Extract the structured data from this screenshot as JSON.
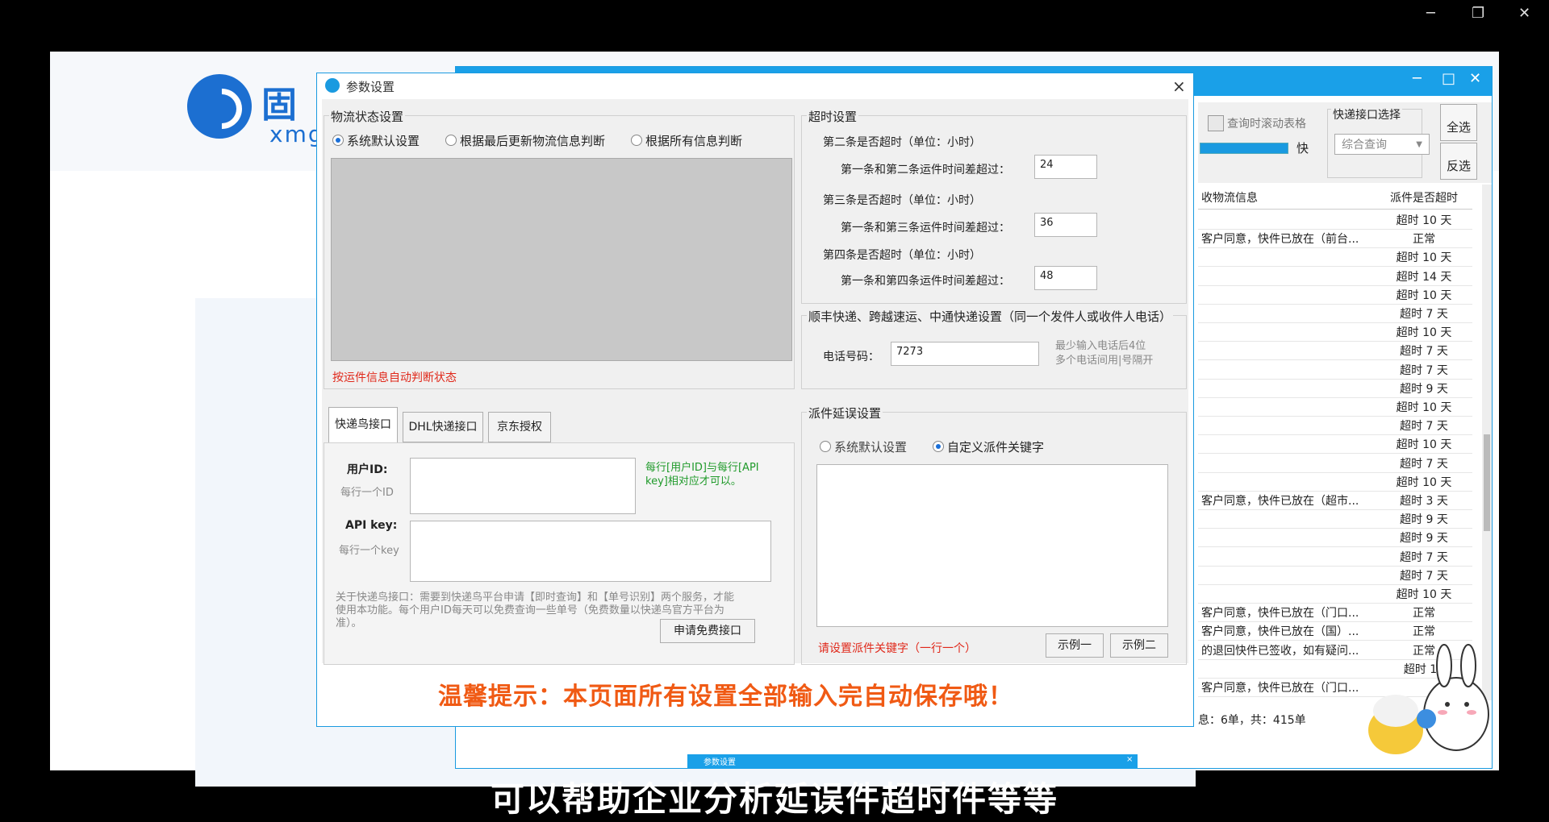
{
  "window_controls": {
    "min": "─",
    "restore": "❐",
    "close": "✕"
  },
  "logo": {
    "text": "固",
    "sub": "xmg"
  },
  "app": {
    "scroll_checkbox_label": "查询时滚动表格",
    "fast_label": "快",
    "api_group_title": "快递接口选择",
    "api_select_value": "综合查询",
    "select_all": "全选",
    "invert_select": "反选",
    "col_info": "收物流信息",
    "col_timeout": "派件是否超时",
    "rows": [
      {
        "info": "",
        "timeout": "超时 10 天"
      },
      {
        "info": "客户同意，快件已放在（前台...",
        "timeout": "正常"
      },
      {
        "info": "",
        "timeout": "超时 10 天"
      },
      {
        "info": "",
        "timeout": "超时 14 天"
      },
      {
        "info": "",
        "timeout": "超时 10 天"
      },
      {
        "info": "",
        "timeout": "超时 7 天"
      },
      {
        "info": "",
        "timeout": "超时 10 天"
      },
      {
        "info": "",
        "timeout": "超时 7 天"
      },
      {
        "info": "",
        "timeout": "超时 7 天"
      },
      {
        "info": "",
        "timeout": "超时 9 天"
      },
      {
        "info": "",
        "timeout": "超时 10 天"
      },
      {
        "info": "",
        "timeout": "超时 7 天"
      },
      {
        "info": "",
        "timeout": "超时 10 天"
      },
      {
        "info": "",
        "timeout": "超时 7 天"
      },
      {
        "info": "",
        "timeout": "超时 10 天"
      },
      {
        "info": "客户同意，快件已放在（超市...",
        "timeout": "超时 3 天"
      },
      {
        "info": "",
        "timeout": "超时 9 天"
      },
      {
        "info": "",
        "timeout": "超时 9 天"
      },
      {
        "info": "",
        "timeout": "超时 7 天"
      },
      {
        "info": "",
        "timeout": "超时 7 天"
      },
      {
        "info": "",
        "timeout": "超时 10 天"
      },
      {
        "info": "客户同意，快件已放在（门口...",
        "timeout": "正常"
      },
      {
        "info": "客户同意，快件已放在（国）...",
        "timeout": "正常"
      },
      {
        "info": "的退回快件已签收，如有疑问...",
        "timeout": "正常"
      },
      {
        "info": "",
        "timeout": "超时 10"
      },
      {
        "info": "客户同意，快件已放在（门口...",
        "timeout": ""
      }
    ],
    "status": "息：6单，共：415单"
  },
  "dialog": {
    "title": "参数设置",
    "close": "×",
    "logistics": {
      "title": "物流状态设置",
      "radio_default": "系统默认设置",
      "radio_last": "根据最后更新物流信息判断",
      "radio_all": "根据所有信息判断",
      "note": "按运件信息自动判断状态"
    },
    "timeout": {
      "title": "超时设置",
      "q2": "第二条是否超时（单位：小时）",
      "q2_label": "第一条和第二条运件时间差超过：",
      "q2_value": "24",
      "q3": "第三条是否超时（单位：小时）",
      "q3_label": "第一条和第三条运件时间差超过：",
      "q3_value": "36",
      "q4": "第四条是否超时（单位：小时）",
      "q4_label": "第一条和第四条运件时间差超过：",
      "q4_value": "48"
    },
    "sf": {
      "title": "顺丰快递、跨越速运、中通快递设置（同一个发件人或收件人电话）",
      "phone_label": "电话号码：",
      "phone_value": "7273",
      "hint1": "最少输入电话后4位",
      "hint2": "多个电话间用|号隔开"
    },
    "tabs": [
      "快递鸟接口",
      "DHL快递接口",
      "京东授权"
    ],
    "kdn": {
      "user_label": "用户ID:",
      "user_sub": "每行一个ID",
      "key_label": "API key:",
      "key_sub": "每行一个key",
      "hint": "每行[用户ID]与每行[API key]相对应才可以。",
      "about": "关于快递鸟接口：需要到快递鸟平台申请【即时查询】和【单号识别】两个服务，才能使用本功能。每个用户ID每天可以免费查询一些单号（免费数量以快递鸟官方平台为准）。",
      "apply_button": "申请免费接口"
    },
    "delay": {
      "title": "派件延误设置",
      "radio_default": "系统默认设置",
      "radio_custom": "自定义派件关键字",
      "note": "请设置派件关键字（一行一个）",
      "example1": "示例一",
      "example2": "示例二"
    },
    "tip": "温馨提示：本页面所有设置全部输入完自动保存哦！"
  },
  "taskbar_mini_title": "参数设置",
  "subtitle": "可以帮助企业分析延误件超时件等等",
  "colors": {
    "accent": "#1aa0e8",
    "tip": "#f05a14",
    "red": "#e0281a",
    "green": "#1f9a2a"
  }
}
